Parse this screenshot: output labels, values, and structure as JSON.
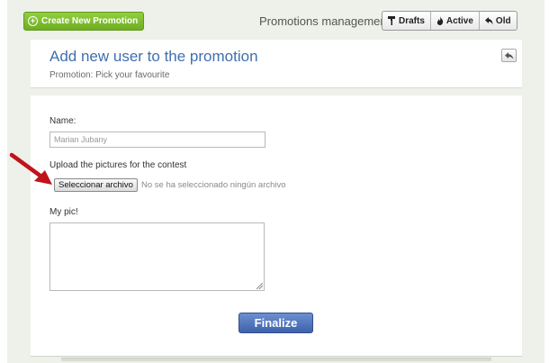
{
  "toolbar": {
    "create_label": "Create New Promotion",
    "section_title": "Promotions management",
    "filters": [
      {
        "label": "Drafts",
        "icon": "paint-roller-icon"
      },
      {
        "label": "Active",
        "icon": "flame-icon"
      },
      {
        "label": "Old",
        "icon": "undo-arrow-icon"
      }
    ]
  },
  "header": {
    "title": "Add new user to the promotion",
    "subtitle": "Promotion: Pick your favourite",
    "back_icon": "back-arrow-icon"
  },
  "form": {
    "name_label": "Name:",
    "name_value": "Marian Jubany",
    "upload_label": "Upload the pictures for the contest",
    "file_button_label": "Seleccionar archivo",
    "file_status": "No se ha seleccionado ningún archivo",
    "pic_label": "My pic!",
    "pic_value": "",
    "submit_label": "Finalize"
  },
  "colors": {
    "create_button": "#7cbd2d",
    "title_blue": "#3f6fae",
    "submit_button": "#4a6fb8",
    "arrow_red": "#c0141b",
    "background": "#eef0ea"
  }
}
